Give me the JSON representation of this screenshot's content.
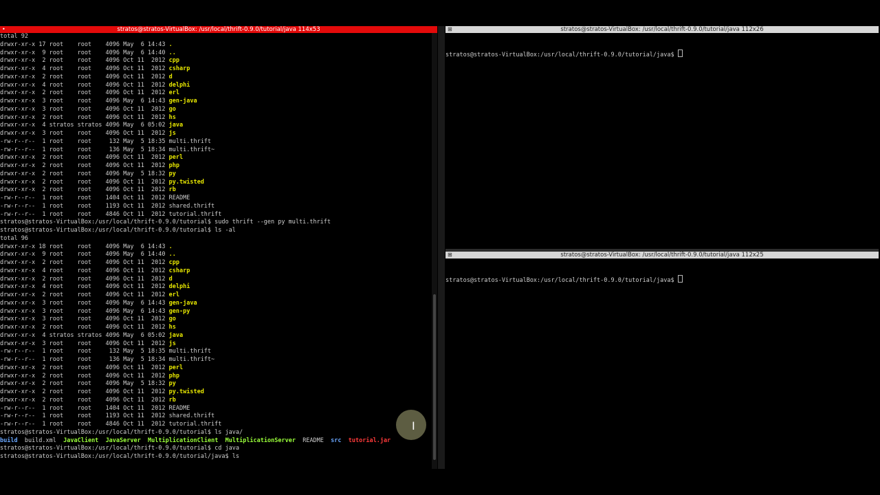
{
  "left_terminal": {
    "title": "stratos@stratos-VirtualBox: /usr/local/thrift-0.9.0/tutorial/java 114x53",
    "dots": "•",
    "lines": [
      [
        {
          "t": "total 92"
        }
      ],
      [
        {
          "t": "drwxr-xr-x 17 root    root    4096 May  6 14:43 "
        },
        {
          "t": ".",
          "c": "dir"
        }
      ],
      [
        {
          "t": "drwxr-xr-x  9 root    root    4096 May  6 14:40 "
        },
        {
          "t": "..",
          "c": "dir"
        }
      ],
      [
        {
          "t": "drwxr-xr-x  2 root    root    4096 Oct 11  2012 "
        },
        {
          "t": "cpp",
          "c": "dir"
        }
      ],
      [
        {
          "t": "drwxr-xr-x  4 root    root    4096 Oct 11  2012 "
        },
        {
          "t": "csharp",
          "c": "dir"
        }
      ],
      [
        {
          "t": "drwxr-xr-x  2 root    root    4096 Oct 11  2012 "
        },
        {
          "t": "d",
          "c": "dir"
        }
      ],
      [
        {
          "t": "drwxr-xr-x  4 root    root    4096 Oct 11  2012 "
        },
        {
          "t": "delphi",
          "c": "dir"
        }
      ],
      [
        {
          "t": "drwxr-xr-x  2 root    root    4096 Oct 11  2012 "
        },
        {
          "t": "erl",
          "c": "dir"
        }
      ],
      [
        {
          "t": "drwxr-xr-x  3 root    root    4096 May  6 14:43 "
        },
        {
          "t": "gen-java",
          "c": "dir"
        }
      ],
      [
        {
          "t": "drwxr-xr-x  3 root    root    4096 Oct 11  2012 "
        },
        {
          "t": "go",
          "c": "dir"
        }
      ],
      [
        {
          "t": "drwxr-xr-x  2 root    root    4096 Oct 11  2012 "
        },
        {
          "t": "hs",
          "c": "dir"
        }
      ],
      [
        {
          "t": "drwxr-xr-x  4 stratos stratos 4096 May  6 05:02 "
        },
        {
          "t": "java",
          "c": "dir"
        }
      ],
      [
        {
          "t": "drwxr-xr-x  3 root    root    4096 Oct 11  2012 "
        },
        {
          "t": "js",
          "c": "dir"
        }
      ],
      [
        {
          "t": "-rw-r--r--  1 root    root     132 May  5 18:35 multi.thrift"
        }
      ],
      [
        {
          "t": "-rw-r--r--  1 root    root     136 May  5 18:34 multi.thrift~"
        }
      ],
      [
        {
          "t": "drwxr-xr-x  2 root    root    4096 Oct 11  2012 "
        },
        {
          "t": "perl",
          "c": "dir"
        }
      ],
      [
        {
          "t": "drwxr-xr-x  2 root    root    4096 Oct 11  2012 "
        },
        {
          "t": "php",
          "c": "dir"
        }
      ],
      [
        {
          "t": "drwxr-xr-x  2 root    root    4096 May  5 18:32 "
        },
        {
          "t": "py",
          "c": "dir"
        }
      ],
      [
        {
          "t": "drwxr-xr-x  2 root    root    4096 Oct 11  2012 "
        },
        {
          "t": "py.twisted",
          "c": "dir"
        }
      ],
      [
        {
          "t": "drwxr-xr-x  2 root    root    4096 Oct 11  2012 "
        },
        {
          "t": "rb",
          "c": "dir"
        }
      ],
      [
        {
          "t": "-rw-r--r--  1 root    root    1404 Oct 11  2012 README"
        }
      ],
      [
        {
          "t": "-rw-r--r--  1 root    root    1193 Oct 11  2012 shared.thrift"
        }
      ],
      [
        {
          "t": "-rw-r--r--  1 root    root    4846 Oct 11  2012 tutorial.thrift"
        }
      ],
      [
        {
          "t": "stratos@stratos-VirtualBox:/usr/local/thrift-0.9.0/tutorial$ sudo thrift --gen py multi.thrift"
        }
      ],
      [
        {
          "t": "stratos@stratos-VirtualBox:/usr/local/thrift-0.9.0/tutorial$ ls -al"
        }
      ],
      [
        {
          "t": "total 96"
        }
      ],
      [
        {
          "t": "drwxr-xr-x 18 root    root    4096 May  6 14:43 "
        },
        {
          "t": ".",
          "c": "dir"
        }
      ],
      [
        {
          "t": "drwxr-xr-x  9 root    root    4096 May  6 14:40 "
        },
        {
          "t": "..",
          "c": "dir"
        }
      ],
      [
        {
          "t": "drwxr-xr-x  2 root    root    4096 Oct 11  2012 "
        },
        {
          "t": "cpp",
          "c": "dir"
        }
      ],
      [
        {
          "t": "drwxr-xr-x  4 root    root    4096 Oct 11  2012 "
        },
        {
          "t": "csharp",
          "c": "dir"
        }
      ],
      [
        {
          "t": "drwxr-xr-x  2 root    root    4096 Oct 11  2012 "
        },
        {
          "t": "d",
          "c": "dir"
        }
      ],
      [
        {
          "t": "drwxr-xr-x  4 root    root    4096 Oct 11  2012 "
        },
        {
          "t": "delphi",
          "c": "dir"
        }
      ],
      [
        {
          "t": "drwxr-xr-x  2 root    root    4096 Oct 11  2012 "
        },
        {
          "t": "erl",
          "c": "dir"
        }
      ],
      [
        {
          "t": "drwxr-xr-x  3 root    root    4096 May  6 14:43 "
        },
        {
          "t": "gen-java",
          "c": "dir"
        }
      ],
      [
        {
          "t": "drwxr-xr-x  3 root    root    4096 May  6 14:43 "
        },
        {
          "t": "gen-py",
          "c": "dir"
        }
      ],
      [
        {
          "t": "drwxr-xr-x  3 root    root    4096 Oct 11  2012 "
        },
        {
          "t": "go",
          "c": "dir"
        }
      ],
      [
        {
          "t": "drwxr-xr-x  2 root    root    4096 Oct 11  2012 "
        },
        {
          "t": "hs",
          "c": "dir"
        }
      ],
      [
        {
          "t": "drwxr-xr-x  4 stratos stratos 4096 May  6 05:02 "
        },
        {
          "t": "java",
          "c": "dir"
        }
      ],
      [
        {
          "t": "drwxr-xr-x  3 root    root    4096 Oct 11  2012 "
        },
        {
          "t": "js",
          "c": "dir"
        }
      ],
      [
        {
          "t": "-rw-r--r--  1 root    root     132 May  5 18:35 multi.thrift"
        }
      ],
      [
        {
          "t": "-rw-r--r--  1 root    root     136 May  5 18:34 multi.thrift~"
        }
      ],
      [
        {
          "t": "drwxr-xr-x  2 root    root    4096 Oct 11  2012 "
        },
        {
          "t": "perl",
          "c": "dir"
        }
      ],
      [
        {
          "t": "drwxr-xr-x  2 root    root    4096 Oct 11  2012 "
        },
        {
          "t": "php",
          "c": "dir"
        }
      ],
      [
        {
          "t": "drwxr-xr-x  2 root    root    4096 May  5 18:32 "
        },
        {
          "t": "py",
          "c": "dir"
        }
      ],
      [
        {
          "t": "drwxr-xr-x  2 root    root    4096 Oct 11  2012 "
        },
        {
          "t": "py.twisted",
          "c": "dir"
        }
      ],
      [
        {
          "t": "drwxr-xr-x  2 root    root    4096 Oct 11  2012 "
        },
        {
          "t": "rb",
          "c": "dir"
        }
      ],
      [
        {
          "t": "-rw-r--r--  1 root    root    1404 Oct 11  2012 README"
        }
      ],
      [
        {
          "t": "-rw-r--r--  1 root    root    1193 Oct 11  2012 shared.thrift"
        }
      ],
      [
        {
          "t": "-rw-r--r--  1 root    root    4846 Oct 11  2012 tutorial.thrift"
        }
      ],
      [
        {
          "t": "stratos@stratos-VirtualBox:/usr/local/thrift-0.9.0/tutorial$ ls java/"
        }
      ],
      [
        {
          "t": "build",
          "c": "blu"
        },
        {
          "t": "  build.xml  "
        },
        {
          "t": "JavaClient",
          "c": "exe"
        },
        {
          "t": "  "
        },
        {
          "t": "JavaServer",
          "c": "exe"
        },
        {
          "t": "  "
        },
        {
          "t": "MultiplicationClient",
          "c": "exe"
        },
        {
          "t": "  "
        },
        {
          "t": "MultiplicationServer",
          "c": "exe"
        },
        {
          "t": "  README  "
        },
        {
          "t": "src",
          "c": "blu"
        },
        {
          "t": "  "
        },
        {
          "t": "tutorial.jar",
          "c": "red"
        }
      ],
      [
        {
          "t": "stratos@stratos-VirtualBox:/usr/local/thrift-0.9.0/tutorial$ cd java"
        }
      ],
      [
        {
          "t": "stratos@stratos-VirtualBox:/usr/local/thrift-0.9.0/tutorial/java$ ls"
        }
      ]
    ]
  },
  "right_top_terminal": {
    "title": "stratos@stratos-VirtualBox: /usr/local/thrift-0.9.0/tutorial/java 112x26",
    "prompt": "stratos@stratos-VirtualBox:/usr/local/thrift-0.9.0/tutorial/java$ "
  },
  "right_bottom_terminal": {
    "title": "stratos@stratos-VirtualBox: /usr/local/thrift-0.9.0/tutorial/java 112x25",
    "prompt": "stratos@stratos-VirtualBox:/usr/local/thrift-0.9.0/tutorial/java$ "
  },
  "colors": {
    "active_title": "#e30a0a",
    "inactive_title": "#d7d7d7",
    "dir": "#e8e800",
    "exe": "#9aff3a",
    "blue": "#6aa7ff",
    "archive": "#ff3a3a"
  },
  "icons": {
    "pane_icon": "split-pane-icon",
    "mouse": "ibeam-cursor-icon"
  },
  "icon_glyphs": {
    "split": "⊞",
    "ibeam": "I"
  }
}
